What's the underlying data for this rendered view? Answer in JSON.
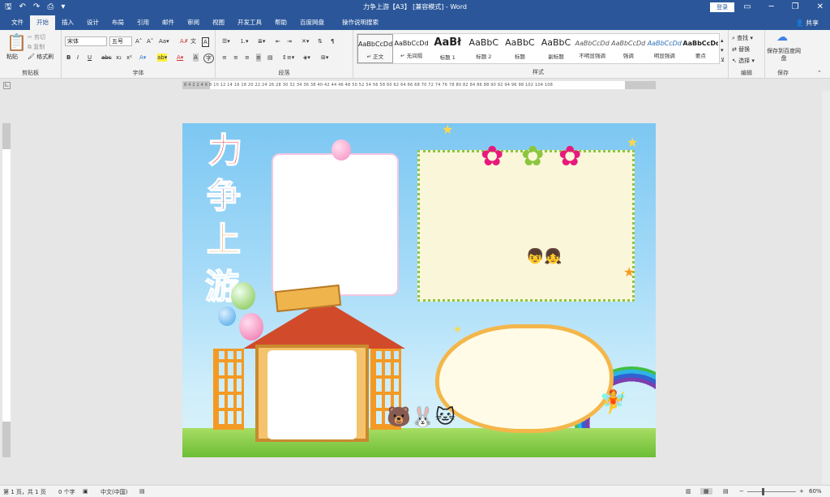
{
  "window": {
    "title": "力争上游【A3】 [兼容模式] - Word",
    "login_label": "登录",
    "share_label": "共享"
  },
  "qat_icons": [
    "save-icon",
    "undo-icon",
    "redo-icon",
    "print-preview-icon",
    "customize-icon"
  ],
  "tabs": [
    "文件",
    "开始",
    "插入",
    "设计",
    "布局",
    "引用",
    "邮件",
    "审阅",
    "视图",
    "开发工具",
    "帮助",
    "百度网盘",
    "操作说明搜索"
  ],
  "active_tab": "开始",
  "ribbon": {
    "clipboard": {
      "paste": "粘贴",
      "cut": "剪切",
      "copy": "复制",
      "format_painter": "格式刷",
      "label": "剪贴板"
    },
    "font": {
      "font_name": "宋体",
      "font_size": "五号",
      "label": "字体",
      "bold": "B",
      "italic": "I",
      "underline": "U",
      "strike": "abc",
      "sub": "x₂",
      "sup": "x²"
    },
    "paragraph": {
      "label": "段落"
    },
    "styles": {
      "label": "样式",
      "items": [
        {
          "preview": "AaBbCcDd",
          "name": "↵ 正文"
        },
        {
          "preview": "AaBbCcDd",
          "name": "↵ 无间隔"
        },
        {
          "preview": "AaBł",
          "name": "标题 1"
        },
        {
          "preview": "AaBbC",
          "name": "标题 2"
        },
        {
          "preview": "AaBbC",
          "name": "标题"
        },
        {
          "preview": "AaBbC",
          "name": "副标题"
        },
        {
          "preview": "AaBbCcDd",
          "name": "不明显强调"
        },
        {
          "preview": "AaBbCcDd",
          "name": "强调"
        },
        {
          "preview": "AaBbCcDd",
          "name": "明显强调"
        },
        {
          "preview": "AaBbCcDd",
          "name": "要点"
        }
      ]
    },
    "editing": {
      "find": "查找",
      "replace": "替换",
      "select": "选择",
      "label": "编辑"
    },
    "save": {
      "btn": "保存到百度网盘",
      "label": "保存"
    }
  },
  "ruler_numbers": "8 4 2   2 4 6 8 10 12 14 16 18 20 22 24 26 28 30 32 34 36 38 40 42 44 46 48 50 52 54 56 58 60 62 64 66 68 70 72 74 76 78 80 82 84 86 88 90 92 94 96 98   102 104 108",
  "document": {
    "title_chars": [
      "力",
      "争",
      "上",
      "游"
    ]
  },
  "status": {
    "page": "第 1 页，共 1 页",
    "words": "0 个字",
    "lang": "中文(中国)",
    "zoom": "60%"
  }
}
